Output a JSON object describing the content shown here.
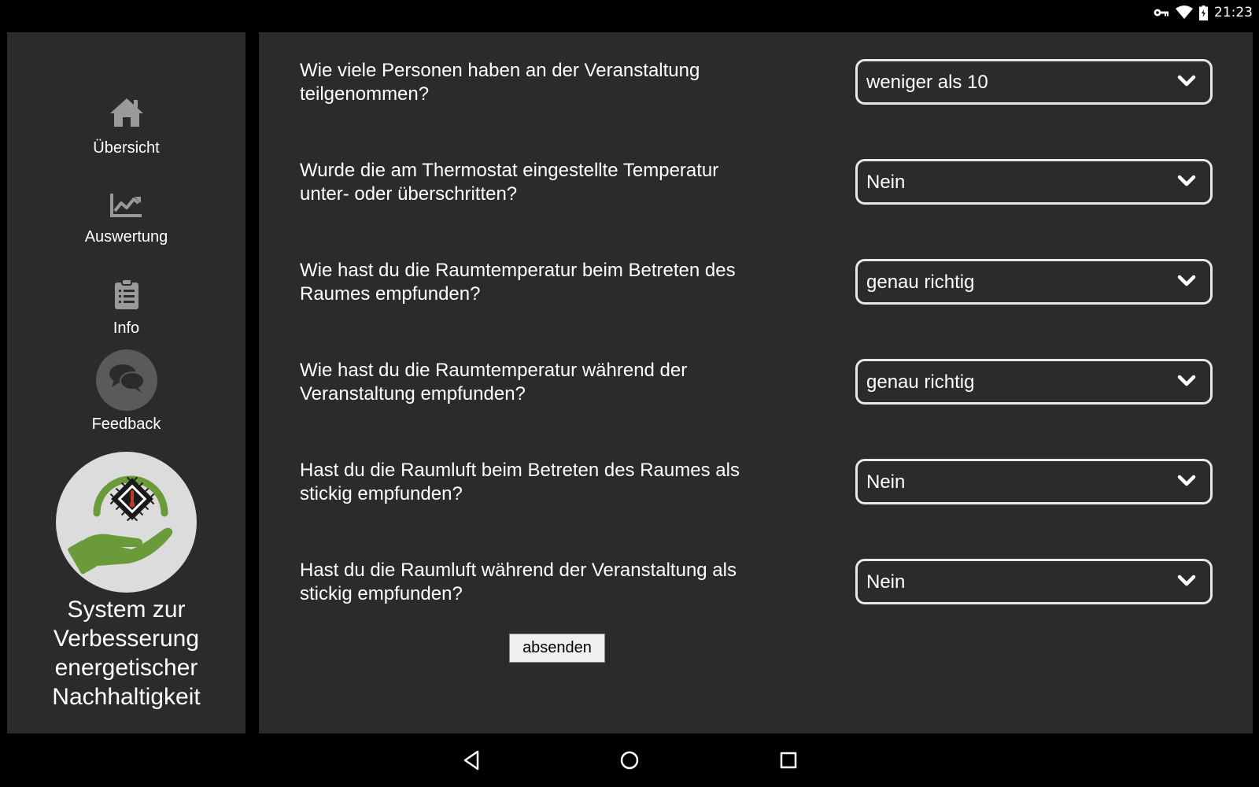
{
  "status_bar": {
    "time": "21:23",
    "icons": [
      "vpn-key-icon",
      "wifi-icon",
      "battery-charging-icon"
    ]
  },
  "sidebar": {
    "items": [
      {
        "label": "Übersicht",
        "icon": "home-icon"
      },
      {
        "label": "Auswertung",
        "icon": "chart-icon"
      },
      {
        "label": "Info",
        "icon": "clipboard-icon"
      },
      {
        "label": "Feedback",
        "icon": "chat-bubbles-icon",
        "active": true
      }
    ],
    "logo_icon": "hand-chip-thermometer-logo",
    "app_title": "System zur Verbesserung energetischer Nachhaltigkeit"
  },
  "form": {
    "questions": [
      {
        "text": "Wie viele Personen haben an der Veranstaltung teilgenommen?",
        "value": "weniger als 10"
      },
      {
        "text": "Wurde die am Thermostat eingestellte Temperatur unter- oder überschritten?",
        "value": "Nein"
      },
      {
        "text": "Wie hast du die Raumtemperatur beim Betreten des Raumes empfunden?",
        "value": "genau richtig"
      },
      {
        "text": "Wie hast du die Raumtemperatur während der Veranstaltung empfunden?",
        "value": "genau richtig"
      },
      {
        "text": "Hast du die Raumluft beim Betreten des Raumes als stickig empfunden?",
        "value": "Nein"
      },
      {
        "text": "Hast du die Raumluft während der Veranstaltung als stickig empfunden?",
        "value": "Nein"
      }
    ],
    "submit_label": "absenden"
  },
  "colors": {
    "background": "#000000",
    "panel": "#2b2b2b",
    "icon": "#9a9a9a",
    "logo_green": "#6a9a3a",
    "logo_bg": "#dcdcdc",
    "select_border": "#e8e8e8"
  },
  "nav_bar": {
    "icons": [
      "back-icon",
      "home-circle-icon",
      "recents-icon"
    ]
  }
}
